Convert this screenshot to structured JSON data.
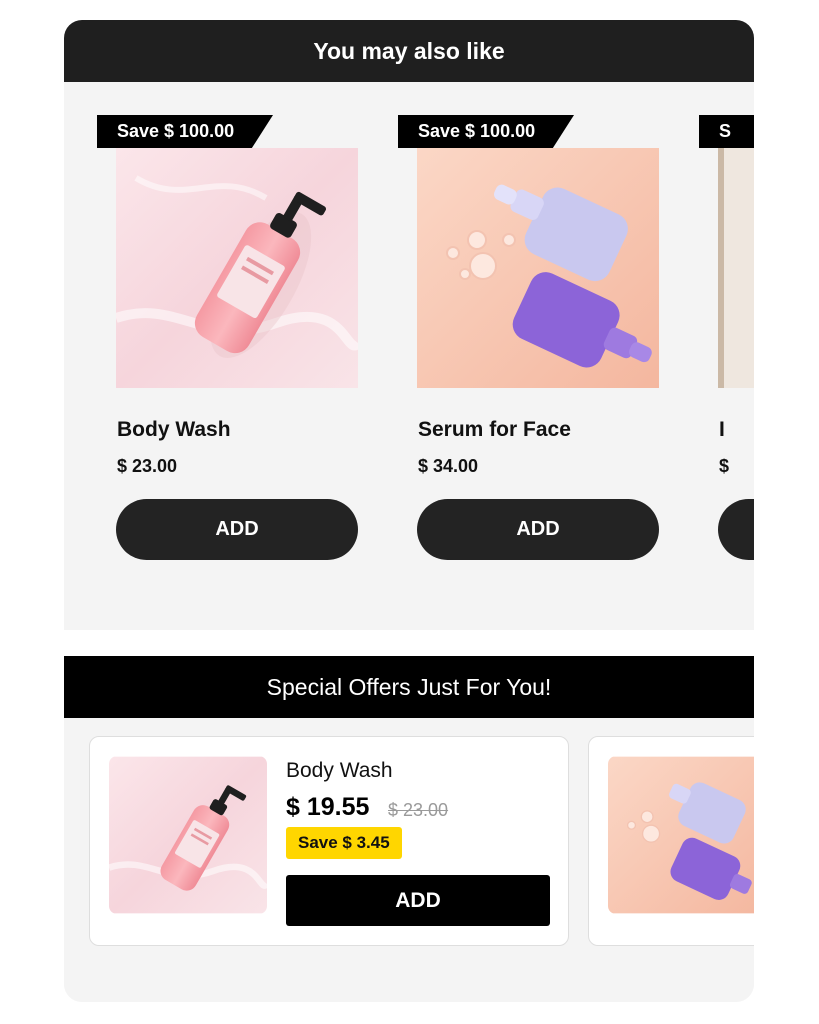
{
  "recommendations": {
    "title": "You may also like",
    "products": [
      {
        "save": "Save $ 100.00",
        "name": "Body Wash",
        "price": "$ 23.00",
        "add_label": "ADD",
        "image_icon": "body-wash-bottle"
      },
      {
        "save": "Save $ 100.00",
        "name": "Serum for Face",
        "price": "$ 34.00",
        "add_label": "ADD",
        "image_icon": "serum-bottles"
      }
    ],
    "partial_card": {
      "save": "S",
      "name": "I",
      "price": "$",
      "image_icon": "product-photo-partial"
    }
  },
  "special_offers": {
    "title": "Special Offers Just For You!",
    "offers": [
      {
        "name": "Body Wash",
        "price": "$ 19.55",
        "old_price": "$ 23.00",
        "save": "Save $ 3.45",
        "add_label": "ADD",
        "image_icon": "body-wash-bottle"
      }
    ],
    "partial_card": {
      "image_icon": "serum-bottles"
    }
  },
  "colors": {
    "header_dark": "#1f1f1f",
    "header_black": "#000000",
    "button_dark": "#232323",
    "save_badge_yellow": "#ffd600",
    "panel_bg": "#f4f4f4"
  }
}
